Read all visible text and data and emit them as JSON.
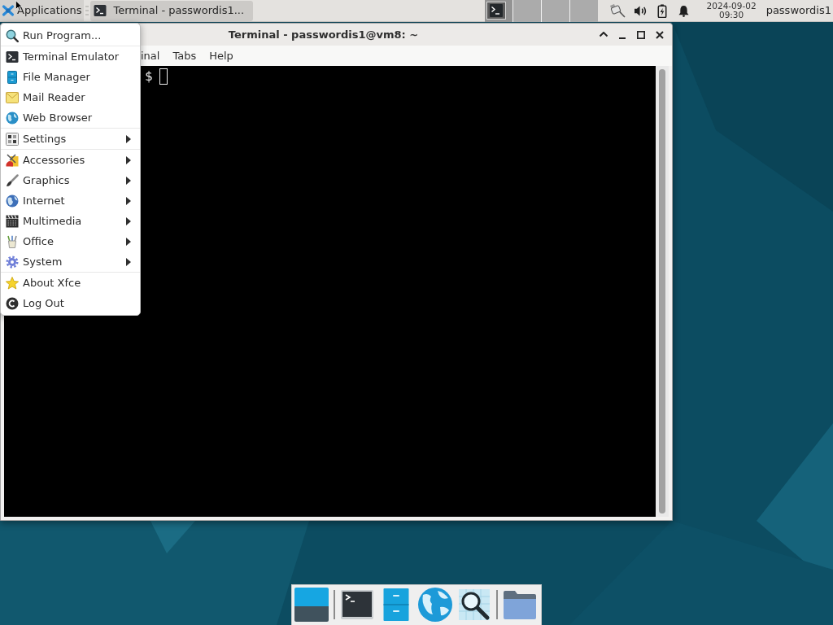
{
  "top_panel": {
    "applications_button": {
      "label": "Applications",
      "expanded": true
    },
    "taskbar": [
      {
        "label": "Terminal - passwordis1...",
        "selected": true
      }
    ],
    "workspaces": [
      {
        "selected": true,
        "has_window": true
      },
      {
        "selected": false,
        "has_window": false
      },
      {
        "selected": false,
        "has_window": false
      },
      {
        "selected": false,
        "has_window": false
      }
    ],
    "clock": {
      "date": "2024-09-02",
      "time": "09:30"
    },
    "user": "passwordis1"
  },
  "terminal_window": {
    "title": "Terminal - passwordis1@vm8: ~",
    "menu_bar": [
      "inal",
      "Tabs",
      "Help"
    ],
    "prompt": "$"
  },
  "applications_menu": {
    "sections": [
      [
        {
          "label": "Run Program...",
          "submenu": false
        }
      ],
      [
        {
          "label": "Terminal Emulator",
          "submenu": false
        },
        {
          "label": "File Manager",
          "submenu": false
        },
        {
          "label": "Mail Reader",
          "submenu": false
        },
        {
          "label": "Web Browser",
          "submenu": false
        }
      ],
      [
        {
          "label": "Settings",
          "submenu": true
        }
      ],
      [
        {
          "label": "Accessories",
          "submenu": true
        },
        {
          "label": "Graphics",
          "submenu": true
        },
        {
          "label": "Internet",
          "submenu": true
        },
        {
          "label": "Multimedia",
          "submenu": true
        },
        {
          "label": "Office",
          "submenu": true
        },
        {
          "label": "System",
          "submenu": true
        }
      ],
      [
        {
          "label": "About Xfce",
          "submenu": false
        },
        {
          "label": "Log Out",
          "submenu": false
        }
      ]
    ]
  }
}
